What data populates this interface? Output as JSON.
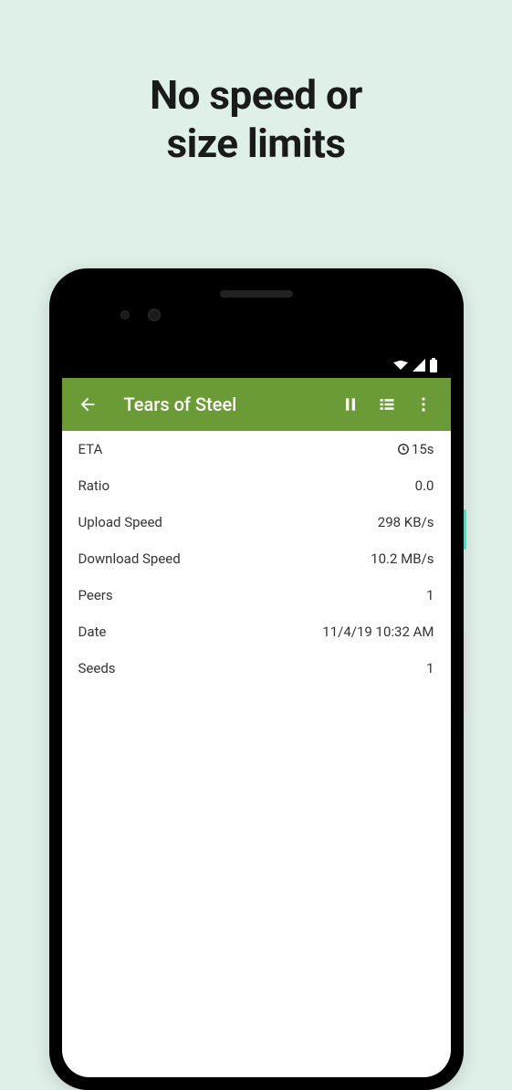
{
  "headline": {
    "line1": "No speed or",
    "line2": "size limits"
  },
  "appBar": {
    "title": "Tears of Steel"
  },
  "details": {
    "rows": [
      {
        "label": "ETA",
        "value": "15s",
        "hasClock": true
      },
      {
        "label": "Ratio",
        "value": "0.0"
      },
      {
        "label": "Upload Speed",
        "value": "298 KB/s"
      },
      {
        "label": "Download Speed",
        "value": "10.2 MB/s"
      },
      {
        "label": "Peers",
        "value": "1"
      },
      {
        "label": "Date",
        "value": "11/4/19 10:32 AM"
      },
      {
        "label": "Seeds",
        "value": "1"
      }
    ]
  }
}
